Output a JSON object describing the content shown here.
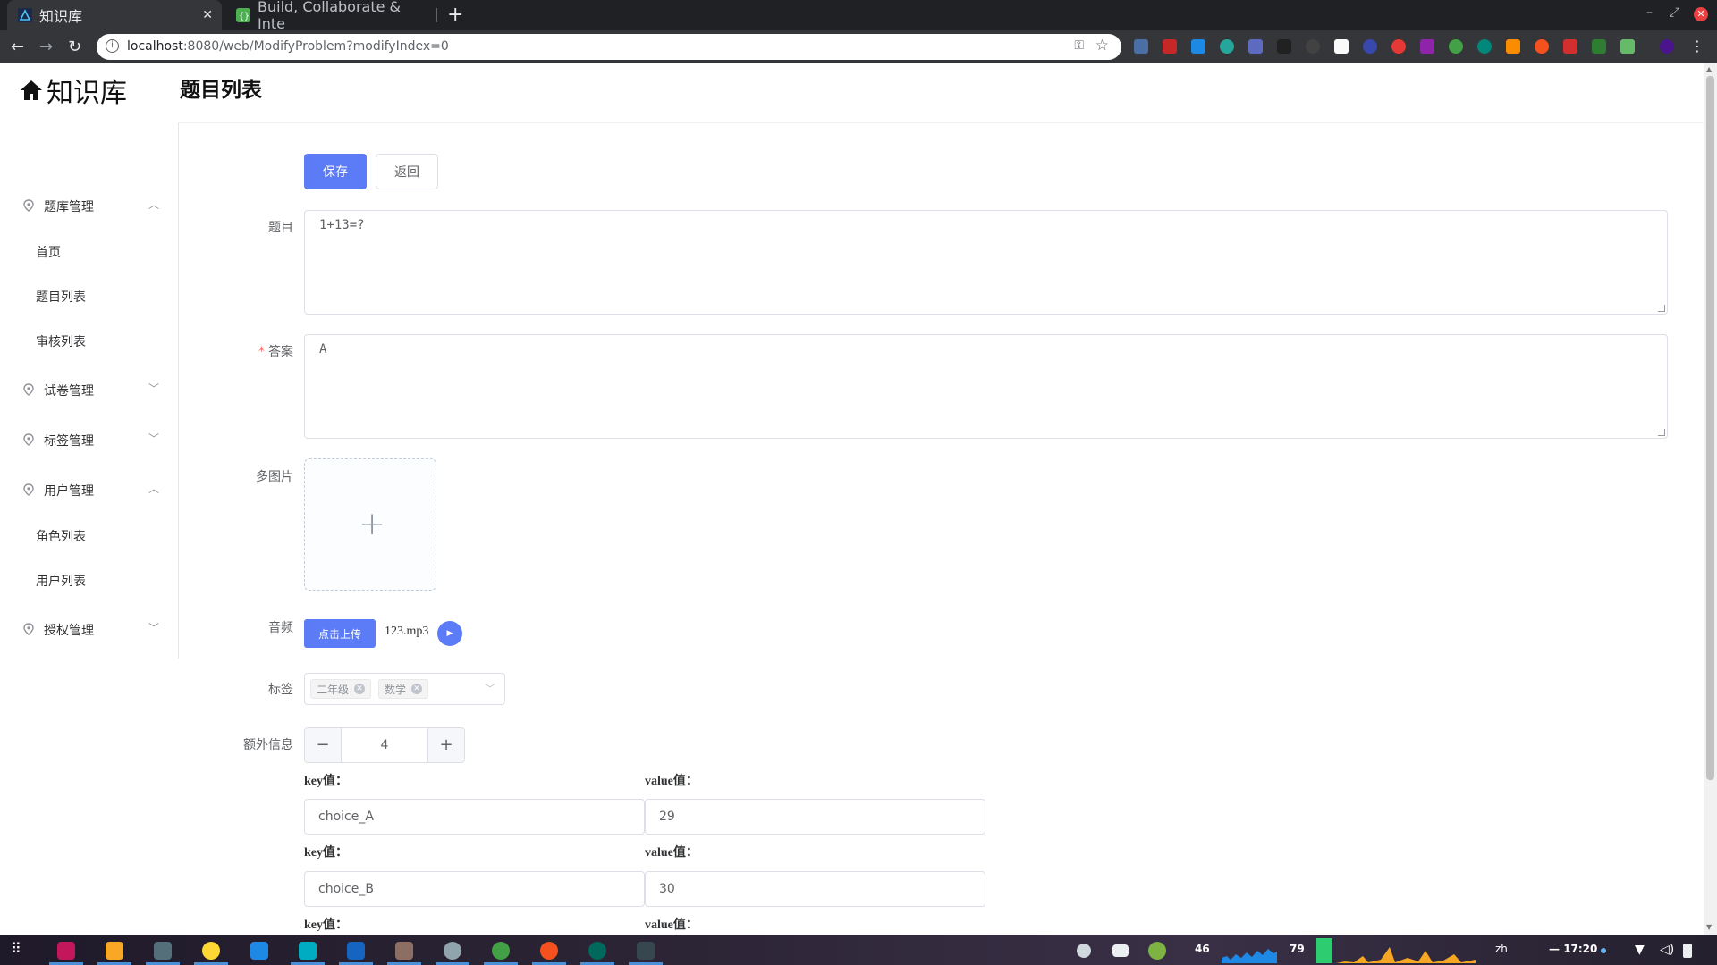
{
  "browser": {
    "tabs": [
      {
        "title": "知识库",
        "active": true
      },
      {
        "title": "Build, Collaborate & Inte",
        "active": false
      }
    ],
    "url_host": "localhost",
    "url_rest": ":8080/web/ModifyProblem?modifyIndex=0"
  },
  "app": {
    "logo_text": "知识库",
    "page_title": "题目列表"
  },
  "sidebar": {
    "groups": [
      {
        "label": "题库管理",
        "expanded": true,
        "items": [
          "首页",
          "题目列表",
          "审核列表"
        ]
      },
      {
        "label": "试卷管理",
        "expanded": false,
        "items": []
      },
      {
        "label": "标签管理",
        "expanded": false,
        "items": []
      },
      {
        "label": "用户管理",
        "expanded": true,
        "items": [
          "角色列表",
          "用户列表"
        ]
      },
      {
        "label": "授权管理",
        "expanded": false,
        "items": []
      }
    ]
  },
  "form": {
    "save_label": "保存",
    "back_label": "返回",
    "question_label": "题目",
    "question_value": "1+13=?",
    "answer_label": "答案",
    "answer_value": "A",
    "images_label": "多图片",
    "audio_label": "音频",
    "upload_label": "点击上传",
    "audio_file": "123.mp3",
    "tags_label": "标签",
    "tags": [
      "二年级",
      "数学"
    ],
    "extra_label": "额外信息",
    "extra_count": "4",
    "key_label": "key值：",
    "value_label": "value值：",
    "kv_pairs": [
      {
        "key": "choice_A",
        "value": "29"
      },
      {
        "key": "choice_B",
        "value": "30"
      }
    ]
  },
  "taskbar": {
    "cpu": "46",
    "mem": "79",
    "lang": "zh",
    "clock": "17:20"
  }
}
